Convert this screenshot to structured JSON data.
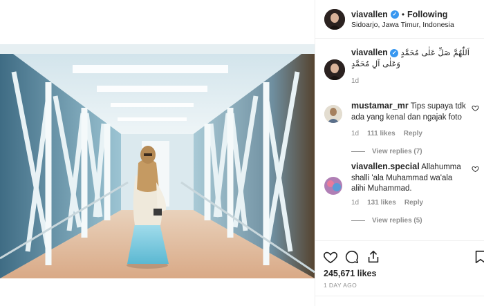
{
  "post": {
    "username": "viavallen",
    "follow_state": "Following",
    "separator": "•",
    "location": "Sidoarjo, Jawa Timur, Indonesia",
    "caption_arabic": "اَللّٰهُمَّ صَلِّ عَلٰى مُحَمَّدٍ وَعَلٰى آلِ مُحَمَّدٍ",
    "caption_time": "1d",
    "likes": "245,671 likes",
    "date": "1 DAY AGO"
  },
  "comments": [
    {
      "username": "mustamar_mr",
      "text": "Tips supaya tdk ada yang kenal dan ngajak foto",
      "time": "1d",
      "likes": "111 likes",
      "reply_label": "Reply",
      "view_replies": "View replies (7)"
    },
    {
      "username": "viavallen.special",
      "text": "Allahumma shalli 'ala Muhammad wa'ala alihi Muhammad.",
      "time": "1d",
      "likes": "131 likes",
      "reply_label": "Reply",
      "view_replies": "View replies (5)"
    }
  ],
  "icons": {
    "verified": "verified-badge-icon",
    "heart": "heart-icon",
    "comment": "comment-icon",
    "share": "share-icon",
    "bookmark": "bookmark-icon"
  },
  "colors": {
    "verified_blue": "#3897f0",
    "muted_text": "#8e8e8e",
    "primary_text": "#262626",
    "divider": "#efefef"
  }
}
